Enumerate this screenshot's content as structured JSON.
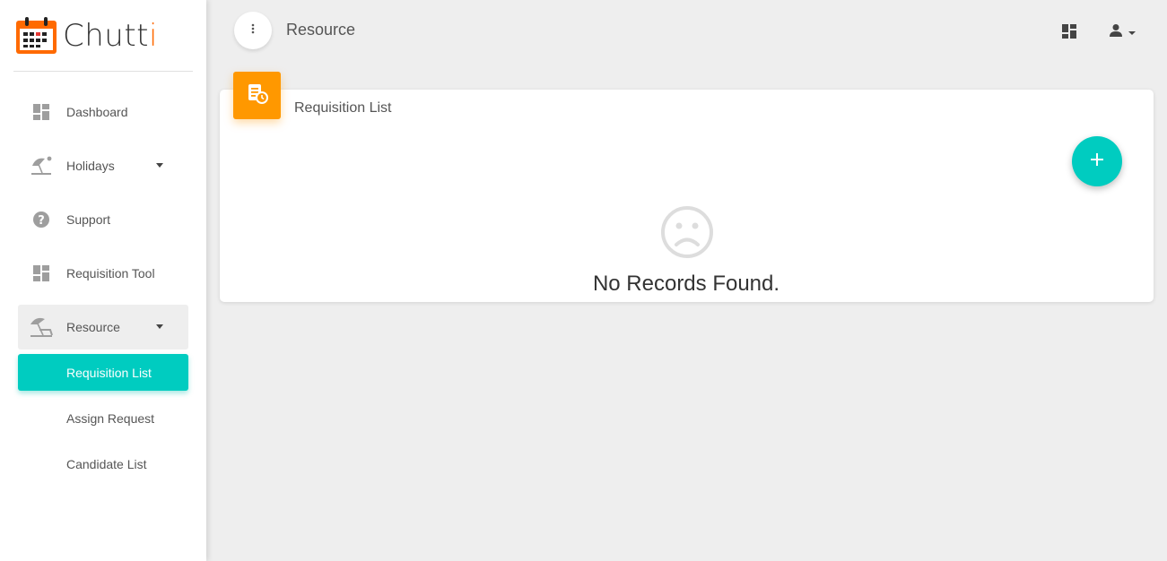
{
  "app": {
    "name_main": "Chutt",
    "name_accent": "i"
  },
  "sidebar": {
    "items": [
      {
        "label": "Dashboard",
        "icon": "dashboard-icon"
      },
      {
        "label": "Holidays",
        "icon": "beach-icon"
      },
      {
        "label": "Support",
        "icon": "help-icon"
      },
      {
        "label": "Requisition Tool",
        "icon": "dashboard-icon"
      },
      {
        "label": "Resource",
        "icon": "beach-icon"
      }
    ],
    "sub_items": [
      {
        "label": "Requisition List"
      },
      {
        "label": "Assign Request"
      },
      {
        "label": "Candidate List"
      }
    ]
  },
  "header": {
    "title": "Resource"
  },
  "card": {
    "title": "Requisition List",
    "empty_message": "No Records Found."
  },
  "colors": {
    "accent": "#00ccc0",
    "badge": "#ff9800",
    "logo": "#ff6a00"
  }
}
